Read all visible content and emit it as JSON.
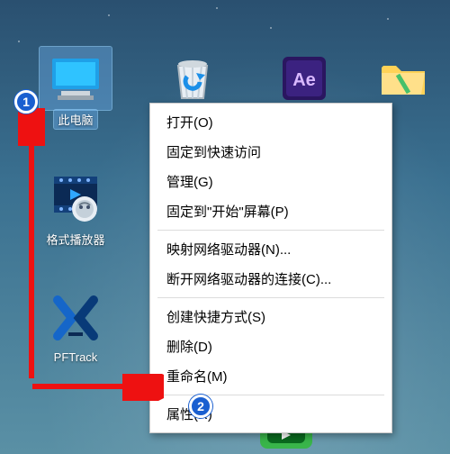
{
  "desktop_icons": {
    "this_pc": "此电脑",
    "media_player": "格式播放器",
    "pftrack": "PFTrack"
  },
  "context_menu": {
    "open": "打开(O)",
    "pin_quick": "固定到快速访问",
    "manage": "管理(G)",
    "pin_start": "固定到\"开始\"屏幕(P)",
    "map_drive": "映射网络驱动器(N)...",
    "disconnect_drive": "断开网络驱动器的连接(C)...",
    "shortcut": "创建快捷方式(S)",
    "delete": "删除(D)",
    "rename": "重命名(M)",
    "properties": "属性(R)"
  },
  "annotations": {
    "step1": "1",
    "step2": "2"
  }
}
